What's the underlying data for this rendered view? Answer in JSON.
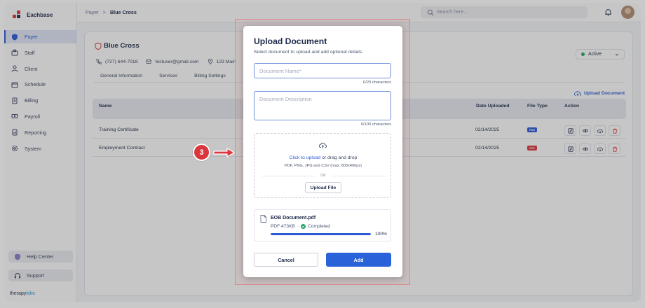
{
  "sidebar": {
    "brand": "Eachbase",
    "items": [
      {
        "label": "Payer",
        "icon": "shield-icon",
        "active": true
      },
      {
        "label": "Staff",
        "icon": "staff-icon"
      },
      {
        "label": "Client",
        "icon": "user-icon"
      },
      {
        "label": "Schedule",
        "icon": "calendar-icon"
      },
      {
        "label": "Billing",
        "icon": "billing-icon"
      },
      {
        "label": "Payroll",
        "icon": "payroll-icon"
      },
      {
        "label": "Reporting",
        "icon": "report-icon"
      },
      {
        "label": "System",
        "icon": "gear-icon"
      }
    ],
    "help_center": "Help Center",
    "support": "Support",
    "footer_brand_a": "therapy",
    "footer_brand_b": "lake"
  },
  "topbar": {
    "breadcrumb_root": "Payer",
    "breadcrumb_sep": ">",
    "breadcrumb_current": "Blue Cross",
    "search_placeholder": "Search here..."
  },
  "payer": {
    "name": "Blue Cross",
    "phone": "(727) 644-7018",
    "email": "testuser@gmail.com",
    "address": "123 Main",
    "status": "Active",
    "tabs": [
      "General Information",
      "Services",
      "Billing Settings"
    ],
    "upload_link": "Upload Document"
  },
  "table": {
    "headers": {
      "name": "Name",
      "date": "Date Uploaded",
      "type": "File Type",
      "action": "Action"
    },
    "rows": [
      {
        "name": "Training Certificate",
        "date": "02/14/2025",
        "type": "PNG",
        "type_color": "#2a5bd7"
      },
      {
        "name": "Employment Contract",
        "date": "02/14/2025",
        "type": "PDF",
        "type_color": "#d9363e"
      }
    ]
  },
  "modal": {
    "title": "Upload Document",
    "subtitle": "Select document to upload and add optional details.",
    "name_placeholder": "Document Name*",
    "name_count": "0/20 characters",
    "desc_placeholder": "Document Description",
    "desc_count": "0/100 characters",
    "drop_link": "Click to upload",
    "drop_text": " or drag and drop",
    "drop_formats": "PDF, PNG, JPG and CSV (max. 800x400px)",
    "or": "OR",
    "upload_button": "Upload File",
    "file_name": "EOB Document.pdf",
    "file_size": "PDF 473KB",
    "file_dot": "·",
    "file_status": "Completed",
    "progress": 1.0,
    "progress_label": "100%",
    "cancel": "Cancel",
    "add": "Add"
  },
  "step_marker": "3",
  "colors": {
    "accent": "#2a5bd7",
    "danger": "#d9363e",
    "success": "#21a366"
  }
}
